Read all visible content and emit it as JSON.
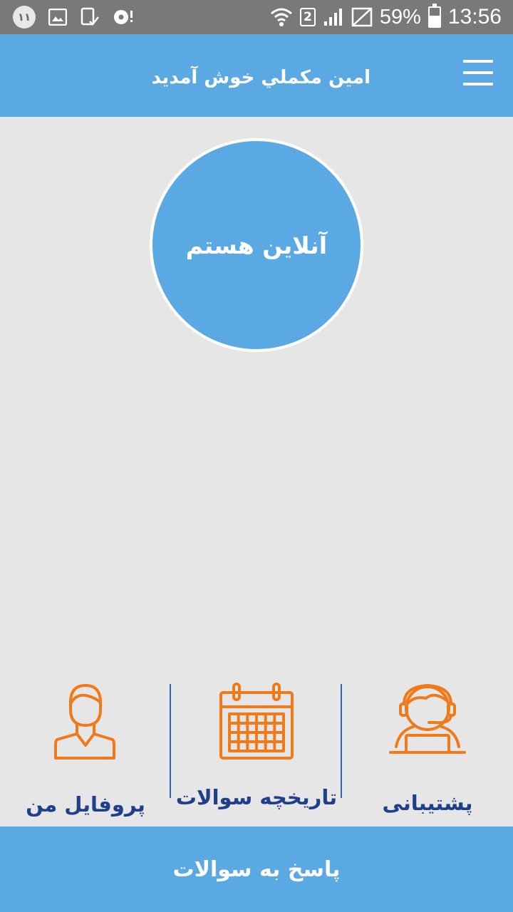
{
  "status_bar": {
    "left_icons": [
      "notification-count-icon",
      "image-icon",
      "tablet-check-icon",
      "disc-icon"
    ],
    "notification_badge": "۱۱",
    "sim_slot": "2",
    "battery_percent": "59%",
    "battery_level": 0.59,
    "time": "13:56"
  },
  "app_bar": {
    "title": "امين  مكملي خوش آمدید",
    "menu_icon": "hamburger-menu-icon",
    "background": "#5aa9e2"
  },
  "status_toggle": {
    "label": "آنلاین هستم"
  },
  "features": [
    {
      "label": "پروفایل من",
      "icon": "user-profile-icon"
    },
    {
      "label": "تاریخچه سوالات",
      "icon": "calendar-icon"
    },
    {
      "label": "پشتیبانی",
      "icon": "support-agent-icon"
    }
  ],
  "bottom_action": {
    "label": "پاسخ به سوالات"
  },
  "colors": {
    "primary": "#5aa9e2",
    "accent_icon": "#f07a1a",
    "feature_label": "#1f3f8a",
    "background": "#e6e6e6"
  }
}
